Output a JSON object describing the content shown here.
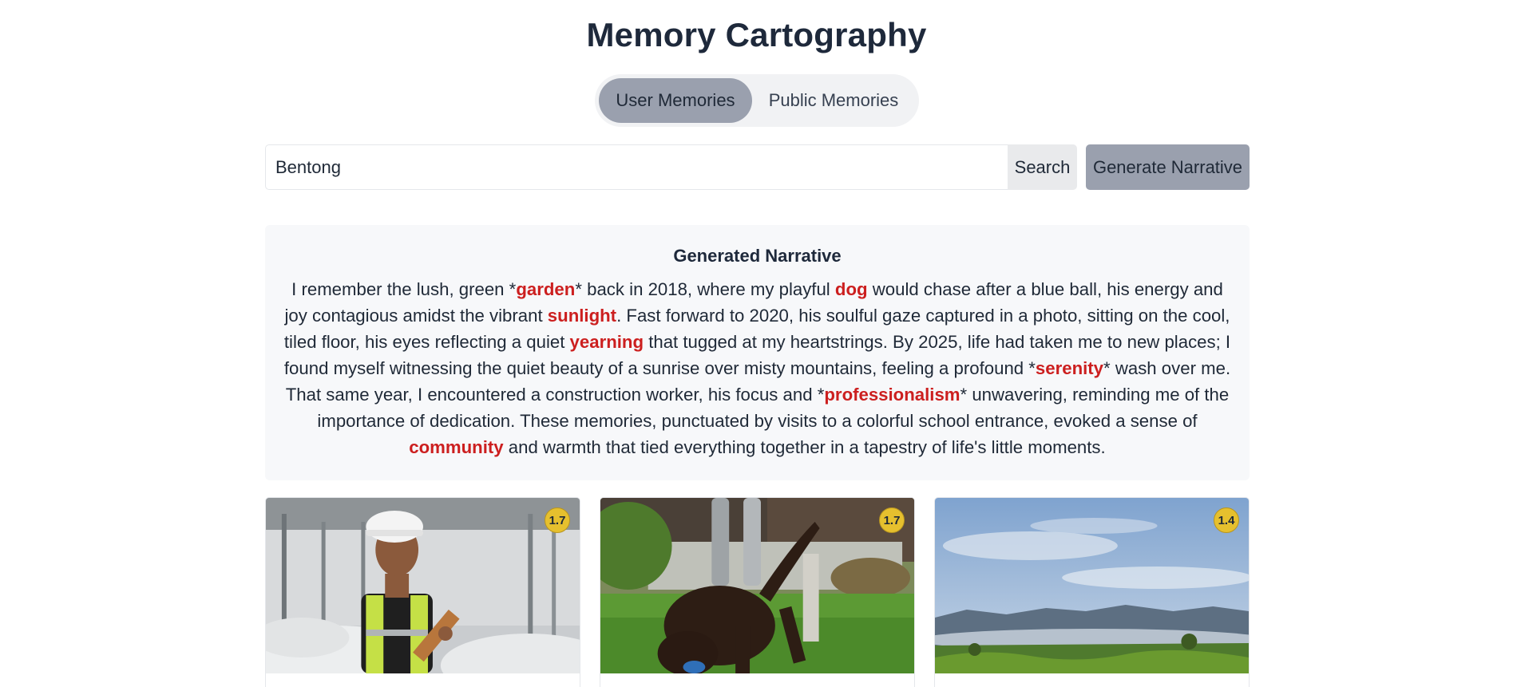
{
  "app": {
    "title": "Memory Cartography"
  },
  "tabs": [
    {
      "label": "User Memories",
      "active": true
    },
    {
      "label": "Public Memories",
      "active": false
    }
  ],
  "search": {
    "value": "Bentong",
    "button_label": "Search"
  },
  "generate_button_label": "Generate Narrative",
  "narrative": {
    "title": "Generated Narrative",
    "segments": [
      {
        "text": "I remember the lush, green *",
        "hl": false
      },
      {
        "text": "garden",
        "hl": true
      },
      {
        "text": "* back in 2018, where my playful ",
        "hl": false
      },
      {
        "text": "dog",
        "hl": true
      },
      {
        "text": " would chase after a blue ball, his energy and joy contagious amidst the vibrant ",
        "hl": false
      },
      {
        "text": "sunlight",
        "hl": true
      },
      {
        "text": ". Fast forward to 2020, his soulful gaze captured in a photo, sitting on the cool, tiled floor, his eyes reflecting a quiet ",
        "hl": false
      },
      {
        "text": "yearning",
        "hl": true
      },
      {
        "text": " that tugged at my heartstrings. By 2025, life had taken me to new places; I found myself witnessing the quiet beauty of a sunrise over misty mountains, feeling a profound *",
        "hl": false
      },
      {
        "text": "serenity",
        "hl": true
      },
      {
        "text": "* wash over me. That same year, I encountered a construction worker, his focus and *",
        "hl": false
      },
      {
        "text": "professionalism",
        "hl": true
      },
      {
        "text": "* unwavering, reminding me of the importance of dedication. These memories, punctuated by visits to a colorful school entrance, evoked a sense of ",
        "hl": false
      },
      {
        "text": "community",
        "hl": true
      },
      {
        "text": " and warmth that tied everything together in a tapestry of life's little moments.",
        "hl": false
      }
    ],
    "highlight_color": "#cc1f1f"
  },
  "cards": [
    {
      "score": "1.7",
      "image": "construction-worker"
    },
    {
      "score": "1.7",
      "image": "dog-in-garden"
    },
    {
      "score": "1.4",
      "image": "misty-mountains"
    }
  ],
  "colors": {
    "accent": "#9aa0ae",
    "badge": "#e6c02e"
  }
}
